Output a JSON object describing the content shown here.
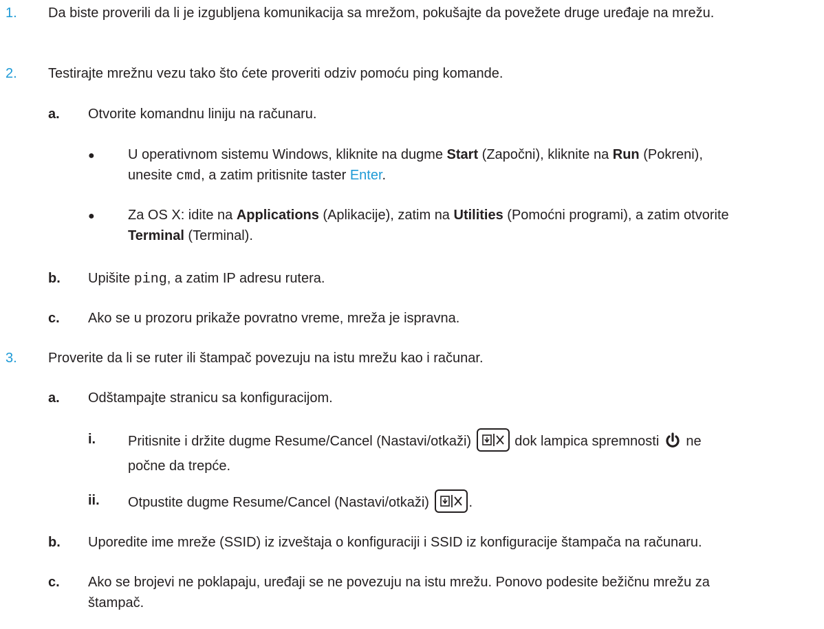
{
  "steps": [
    {
      "number": "1.",
      "text": "Da biste proverili da li je izgubljena komunikacija sa mrežom, pokušajte da povežete druge uređaje na mrežu."
    },
    {
      "number": "2.",
      "text": "Testirajte mrežnu vezu tako što ćete proveriti odziv pomoću ping komande.",
      "substeps": [
        {
          "letter": "a.",
          "text": "Otvorite komandnu liniju na računaru.",
          "bullets": [
            {
              "p1": "U operativnom sistemu Windows, kliknite na dugme ",
              "b1": "Start",
              "p2": " (Započni), kliknite na ",
              "b2": "Run",
              "p3": " (Pokreni),",
              "p4": "unesite ",
              "code": "cmd",
              "p5": ", a zatim pritisnite taster ",
              "key": "Enter",
              "p6": "."
            },
            {
              "p1": "Za OS X: idite na ",
              "b1": "Applications",
              "p2": " (Aplikacije), zatim na ",
              "b2": "Utilities",
              "p3": " (Pomoćni programi), a zatim otvorite",
              "b3": "Terminal",
              "p4": " (Terminal)."
            }
          ]
        },
        {
          "letter": "b.",
          "p1": "Upišite ",
          "code": "ping",
          "p2": ", a zatim IP adresu rutera."
        },
        {
          "letter": "c.",
          "text": "Ako se u prozoru prikaže povratno vreme, mreža je ispravna."
        }
      ]
    },
    {
      "number": "3.",
      "text": "Proverite da li se ruter ili štampač povezuju na istu mrežu kao i računar.",
      "substeps": [
        {
          "letter": "a.",
          "text": "Odštampajte stranicu sa konfiguracijom.",
          "roman": [
            {
              "numeral": "i.",
              "p1": "Pritisnite i držite dugme Resume/Cancel (Nastavi/otkaži)",
              "p2": "dok lampica spremnosti",
              "p3": "ne",
              "p4": "počne da trepće."
            },
            {
              "numeral": "ii.",
              "p1": "Otpustite dugme Resume/Cancel (Nastavi/otkaži)",
              "p2": "."
            }
          ]
        },
        {
          "letter": "b.",
          "text": "Uporedite ime mreže (SSID) iz izveštaja o konfiguraciji i SSID iz konfiguracije štampača na računaru."
        },
        {
          "letter": "c.",
          "line1": "Ako se brojevi ne poklapaju, uređaji se ne povezuju na istu mrežu. Ponovo podesite bežičnu mrežu za",
          "line2": "štampač."
        }
      ]
    }
  ],
  "icons": {
    "resume_cancel": "resume-cancel-button-icon",
    "power": "ready-light-power-icon"
  },
  "colors": {
    "accent": "#1e9ad6",
    "text": "#231f20"
  }
}
